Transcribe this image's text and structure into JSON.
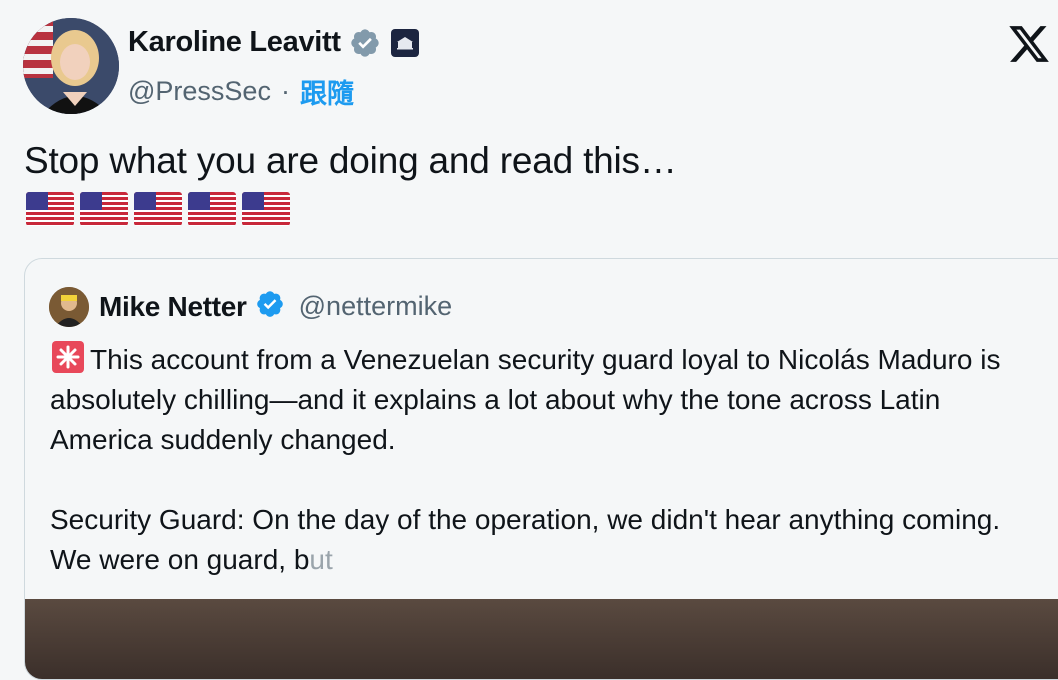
{
  "author": {
    "display_name": "Karoline Leavitt",
    "handle": "@PressSec",
    "separator": "·",
    "follow_label": "跟隨"
  },
  "tweet": {
    "text": "Stop what you are doing and read this…",
    "flag_count_emoji": "🇺🇸🇺🇸🇺🇸🇺🇸🇺🇸"
  },
  "quote": {
    "display_name": "Mike Netter",
    "handle": "@nettermike",
    "paragraph1": "This account from a Venezuelan security guard loyal to Nicolás Maduro is absolutely chilling—and it explains a lot about why the tone across Latin America suddenly changed.",
    "paragraph2_visible": "Security Guard: On the day of the operation, we didn't hear anything coming. We were on guard, b",
    "paragraph2_faded": "ut"
  },
  "icons": {
    "verified": "verified-badge-icon",
    "affiliate": "white-house-affiliate-icon",
    "brand": "x-logo-icon",
    "siren": "siren-emoji-icon"
  },
  "colors": {
    "accent": "#1d9bf0",
    "gov_badge": "#829aab",
    "text": "#0f1419",
    "muted": "#536471",
    "background": "#f5f7f8"
  }
}
